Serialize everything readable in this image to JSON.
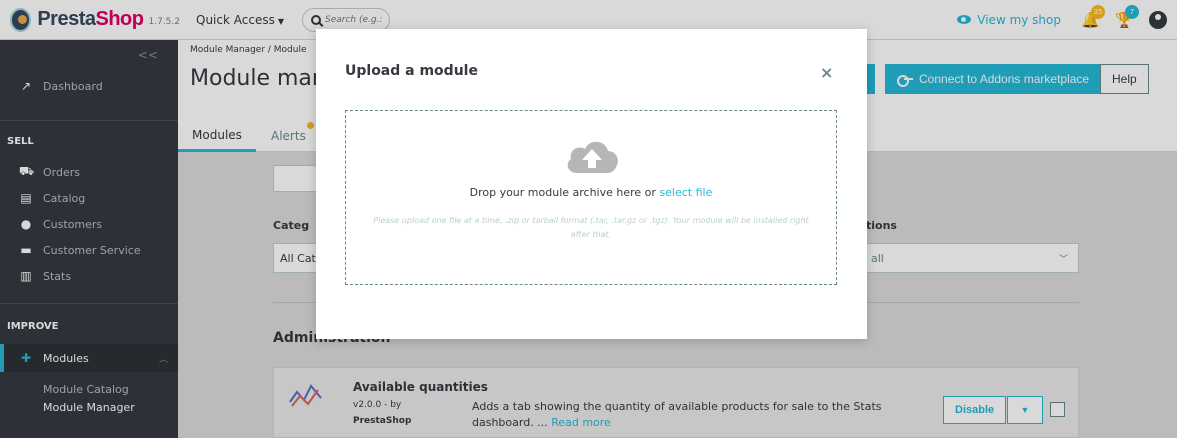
{
  "topbar": {
    "brand": "Presta",
    "brand_accent": "Shop",
    "version": "1.7.5.2",
    "quick_access": "Quick Access",
    "search_placeholder": "Search (e.g.: produ",
    "view_shop": "View my shop",
    "notif_orders": "35",
    "notif_customers": "7"
  },
  "sidebar": {
    "collapse": "<<",
    "dashboard": "Dashboard",
    "sections": {
      "sell": "SELL",
      "improve": "IMPROVE"
    },
    "sell_items": [
      "Orders",
      "Catalog",
      "Customers",
      "Customer Service",
      "Stats"
    ],
    "modules": "Modules",
    "sub_items": [
      "Module Catalog",
      "Module Manager"
    ]
  },
  "header": {
    "breadcrumb": "Module Manager / Module",
    "title": "Module man",
    "connect_label": "Connect to Addons marketplace",
    "help_label": "Help",
    "tabs": [
      "Modules",
      "Alerts"
    ]
  },
  "main": {
    "category_label": "Categ",
    "category_value": "All Cate",
    "options_label": "tions",
    "options_value": "all",
    "section_title": "Administration",
    "module": {
      "name": "Available quantities",
      "version": "v2.0.0 - by",
      "author": "PrestaShop",
      "description": "Adds a tab showing the quantity of available products for sale to the Stats dashboard. ...",
      "read_more": "Read more",
      "disable_label": "Disable"
    }
  },
  "modal": {
    "title": "Upload a module",
    "close": "×",
    "drop_text": "Drop your module archive here or",
    "select_file": "select file",
    "hint": "Please upload one file at a time, .zip or tarball format (.tar, .tar.gz or .tgz). Your module will be installed right after that."
  },
  "colors": {
    "accent": "#25b9d7",
    "sidebar": "#363a41",
    "warning": "#fbbb22"
  }
}
